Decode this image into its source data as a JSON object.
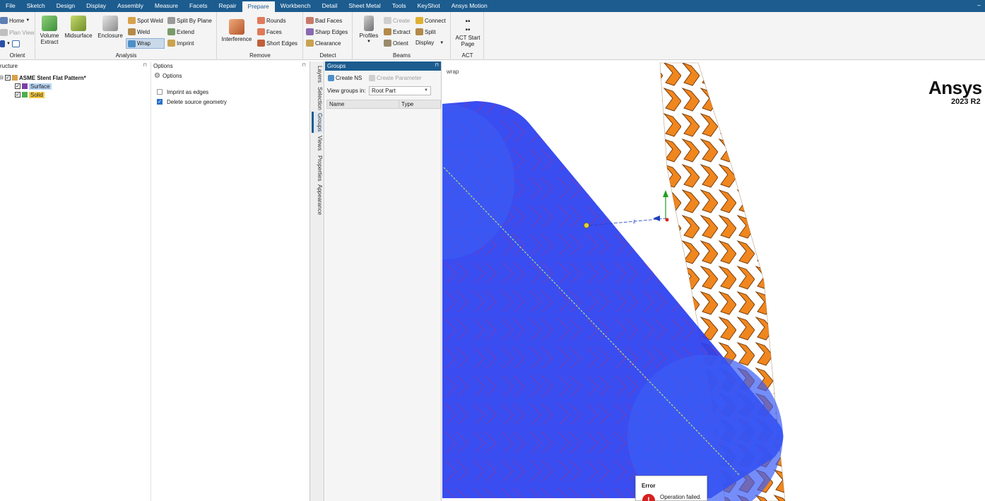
{
  "menubar": {
    "items": [
      "File",
      "Sketch",
      "Design",
      "Display",
      "Assembly",
      "Measure",
      "Facets",
      "Repair",
      "Prepare",
      "Workbench",
      "Detail",
      "Sheet Metal",
      "Tools",
      "KeyShot",
      "Ansys Motion"
    ],
    "active": "Prepare",
    "minimize": "–"
  },
  "ribbon": {
    "orient": {
      "home": "Home",
      "plan_view": "Plan View",
      "label": "Orient"
    },
    "analysis": {
      "volume_extract": "Volume Extract",
      "midsurface": "Midsurface",
      "enclosure": "Enclosure",
      "spot_weld": "Spot Weld",
      "weld": "Weld",
      "wrap": "Wrap",
      "split_by_plane": "Split By Plane",
      "extend": "Extend",
      "imprint": "Imprint",
      "label": "Analysis"
    },
    "remove": {
      "interference": "Interference",
      "rounds": "Rounds",
      "faces": "Faces",
      "short_edges": "Short Edges",
      "label": "Remove"
    },
    "detect": {
      "bad_faces": "Bad Faces",
      "sharp_edges": "Sharp Edges",
      "clearance": "Clearance",
      "label": "Detect"
    },
    "beams": {
      "profiles": "Profiles",
      "create": "Create",
      "extract": "Extract",
      "orient": "Orient",
      "connect": "Connect",
      "split": "Split",
      "display": "Display",
      "label": "Beams"
    },
    "act": {
      "start_page": "ACT Start Page",
      "label": "ACT"
    }
  },
  "structure": {
    "title": "ructure",
    "root": "ASME Stent Flat Pattern*",
    "items": [
      "Surface",
      "Solid"
    ]
  },
  "options": {
    "title": "Options",
    "header": "Options",
    "imprint_as_edges": "Imprint as edges",
    "delete_source_geometry": "Delete source geometry",
    "imprint_checked": false,
    "delete_checked": true
  },
  "side_tabs": [
    "Layers",
    "Selection",
    "Groups",
    "Views",
    "Properties",
    "Appearance"
  ],
  "groups": {
    "title": "Groups",
    "create_ns": "Create NS",
    "create_parameter": "Create Parameter",
    "view_groups_in_label": "View groups in:",
    "view_groups_in_value": "Root Part",
    "columns": [
      "Name",
      "Type"
    ]
  },
  "viewport": {
    "label": "wrap",
    "brand": "Ansys",
    "version": "2023 R2",
    "axis_label": "Z"
  },
  "error": {
    "title": "Error",
    "message": "Operation failed.",
    "icon": "!"
  },
  "colors": {
    "accent": "#1c5c8f",
    "cylinder": "#2a3ff0",
    "stent": "#f0861e",
    "error": "#d72020"
  }
}
